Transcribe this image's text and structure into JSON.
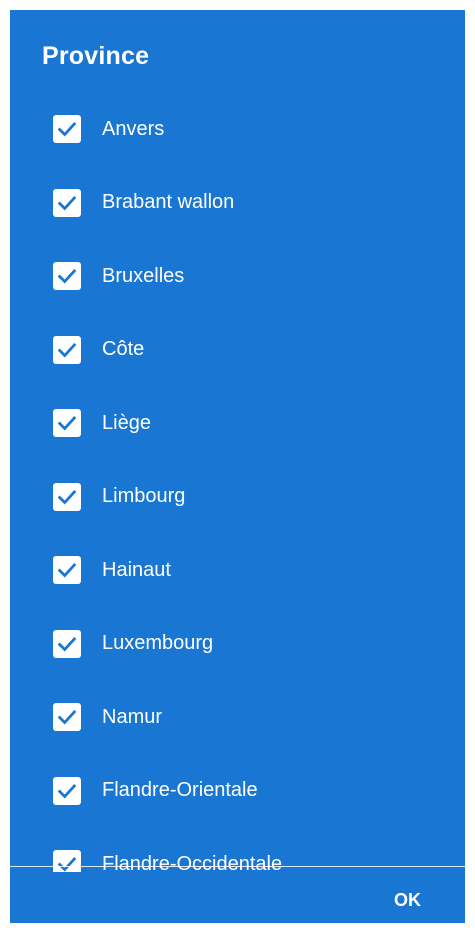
{
  "dialog": {
    "title": "Province",
    "items": [
      {
        "label": "Anvers",
        "checked": true
      },
      {
        "label": "Brabant wallon",
        "checked": true
      },
      {
        "label": "Bruxelles",
        "checked": true
      },
      {
        "label": "Côte",
        "checked": true
      },
      {
        "label": "Liège",
        "checked": true
      },
      {
        "label": "Limbourg",
        "checked": true
      },
      {
        "label": "Hainaut",
        "checked": true
      },
      {
        "label": "Luxembourg",
        "checked": true
      },
      {
        "label": "Namur",
        "checked": true
      },
      {
        "label": "Flandre-Orientale",
        "checked": true
      },
      {
        "label": "Flandre-Occidentale",
        "checked": true
      }
    ],
    "ok_label": "OK"
  },
  "colors": {
    "background": "#1976D2",
    "checkbox": "#ffffff",
    "check_mark": "#1976D2",
    "text": "#ffffff"
  },
  "icons": {
    "checkbox": "check-mark-icon"
  }
}
